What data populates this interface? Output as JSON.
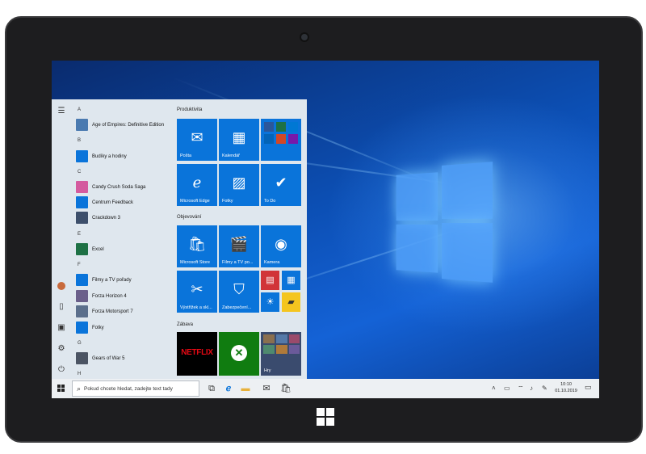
{
  "start_menu": {
    "rail_icons": [
      "hamburger-icon",
      "user-avatar",
      "document-icon",
      "pictures-icon",
      "settings-icon",
      "power-icon"
    ],
    "letters": [
      "A",
      "B",
      "C",
      "E",
      "F",
      "G",
      "H"
    ],
    "apps": [
      {
        "label": "Age of Empires: Definitive Edition",
        "color": "#4a7ab0"
      },
      {
        "label": "Budíky a hodiny",
        "color": "#0a74da"
      },
      {
        "label": "Candy Crush Soda Saga",
        "color": "#d45b9f"
      },
      {
        "label": "Centrum Feedback",
        "color": "#0a74da"
      },
      {
        "label": "Crackdown 3",
        "color": "#3d4f6b"
      },
      {
        "label": "Excel",
        "color": "#1e7145"
      },
      {
        "label": "Filmy a TV pořady",
        "color": "#0a74da"
      },
      {
        "label": "Forza Horizon 4",
        "color": "#6a5f8a"
      },
      {
        "label": "Forza Motorsport 7",
        "color": "#5b6f8c"
      },
      {
        "label": "Fotky",
        "color": "#0a74da"
      },
      {
        "label": "Gears of War 5",
        "color": "#4b5463"
      }
    ],
    "groups": {
      "productivity": "Produktivita",
      "explore": "Objevování",
      "fun": "Zábava"
    },
    "tiles": {
      "mail": "Pošta",
      "calendar": "Kalendář",
      "edge": "Microsoft Edge",
      "photos": "Fotky",
      "todo": "To Do",
      "store": "Microsoft Store",
      "movies": "Filmy a TV po...",
      "camera": "Kamera",
      "snip": "Výstřižek a skl...",
      "security": "Zabezpečení...",
      "games": "Hry",
      "netflix": "NETFLIX"
    }
  },
  "taskbar": {
    "search_placeholder": "Pokud chcete hledat, zadejte text tady",
    "time": "10:10",
    "date": "01.10.2019"
  },
  "colors": {
    "accent": "#0a74da",
    "desktop": "#0c4fb4"
  }
}
